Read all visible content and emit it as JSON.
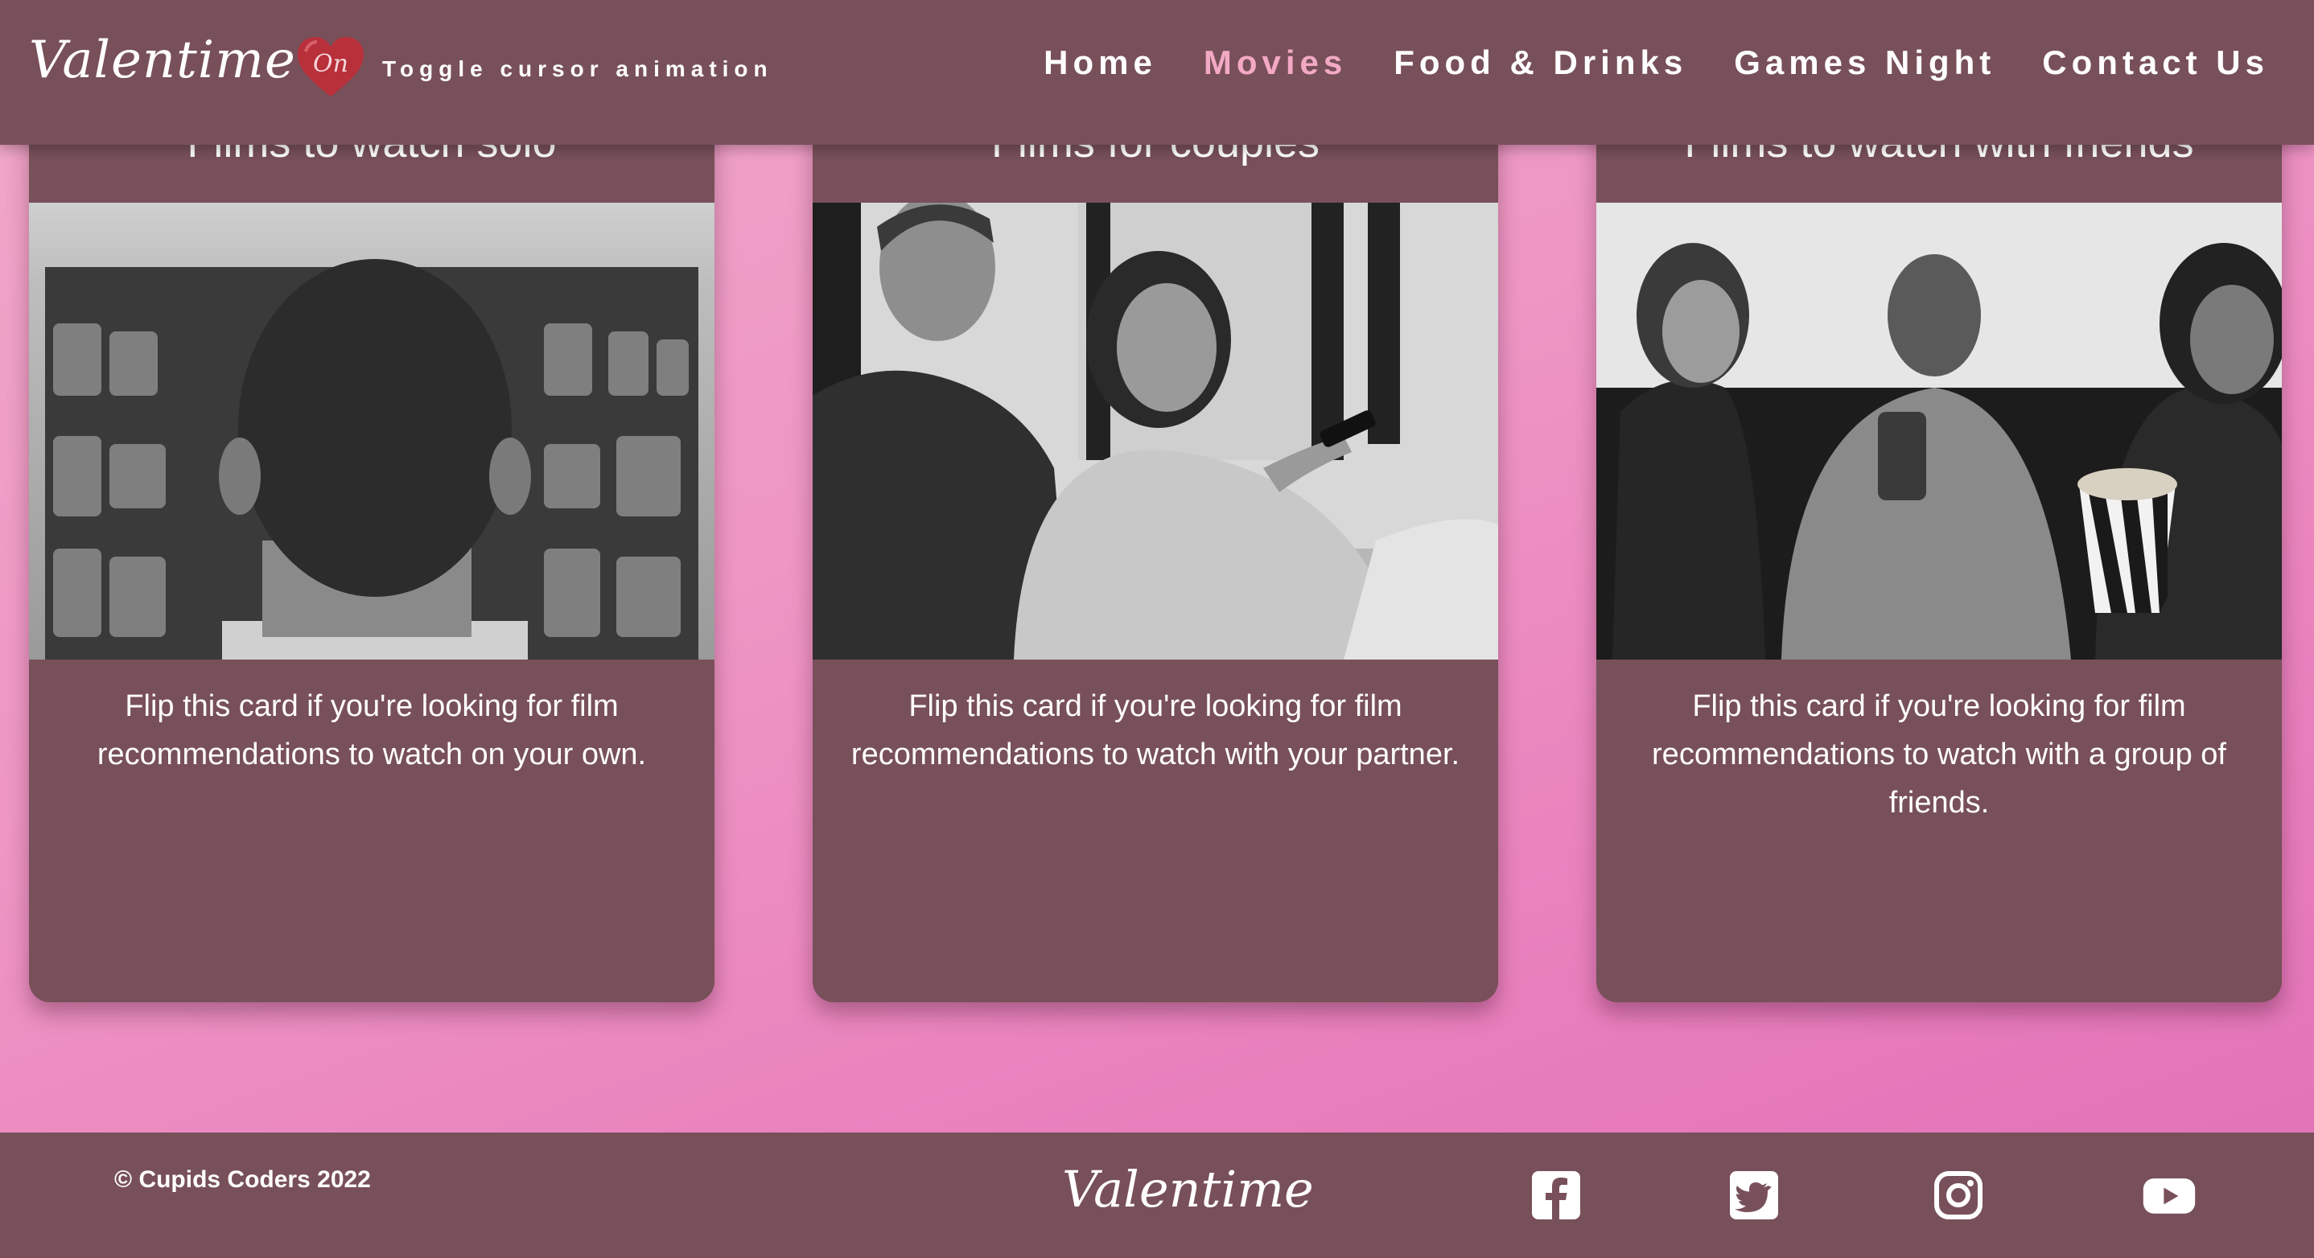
{
  "header": {
    "logo": "Valentime",
    "toggle_state": "On",
    "toggle_label": "Toggle cursor animation",
    "nav": [
      {
        "label": "Home",
        "active": false
      },
      {
        "label": "Movies",
        "active": true
      },
      {
        "label": "Food & Drinks",
        "active": false
      },
      {
        "label": "Games Night",
        "active": false
      },
      {
        "label": "Contact Us",
        "active": false
      }
    ]
  },
  "cards": [
    {
      "title": "Films to watch solo",
      "image_icon": "man-watching-tv-image",
      "text": "Flip this card if you're looking for film recommendations to watch on your own."
    },
    {
      "title": "Films for couples",
      "image_icon": "couple-on-sofa-image",
      "text": "Flip this card if you're looking for film recommendations to watch with your partner."
    },
    {
      "title": "Films to watch with friends",
      "image_icon": "friends-with-popcorn-image",
      "text": "Flip this card if you're looking for film recommendations to watch with a group of friends."
    }
  ],
  "footer": {
    "copyright": "© Cupids Coders 2022",
    "logo": "Valentime",
    "social": [
      "facebook-icon",
      "twitter-icon",
      "instagram-icon",
      "youtube-icon"
    ]
  },
  "colors": {
    "panel": "#78505a",
    "accent_pink": "#f3a9c4",
    "heart": "#b8303a"
  }
}
